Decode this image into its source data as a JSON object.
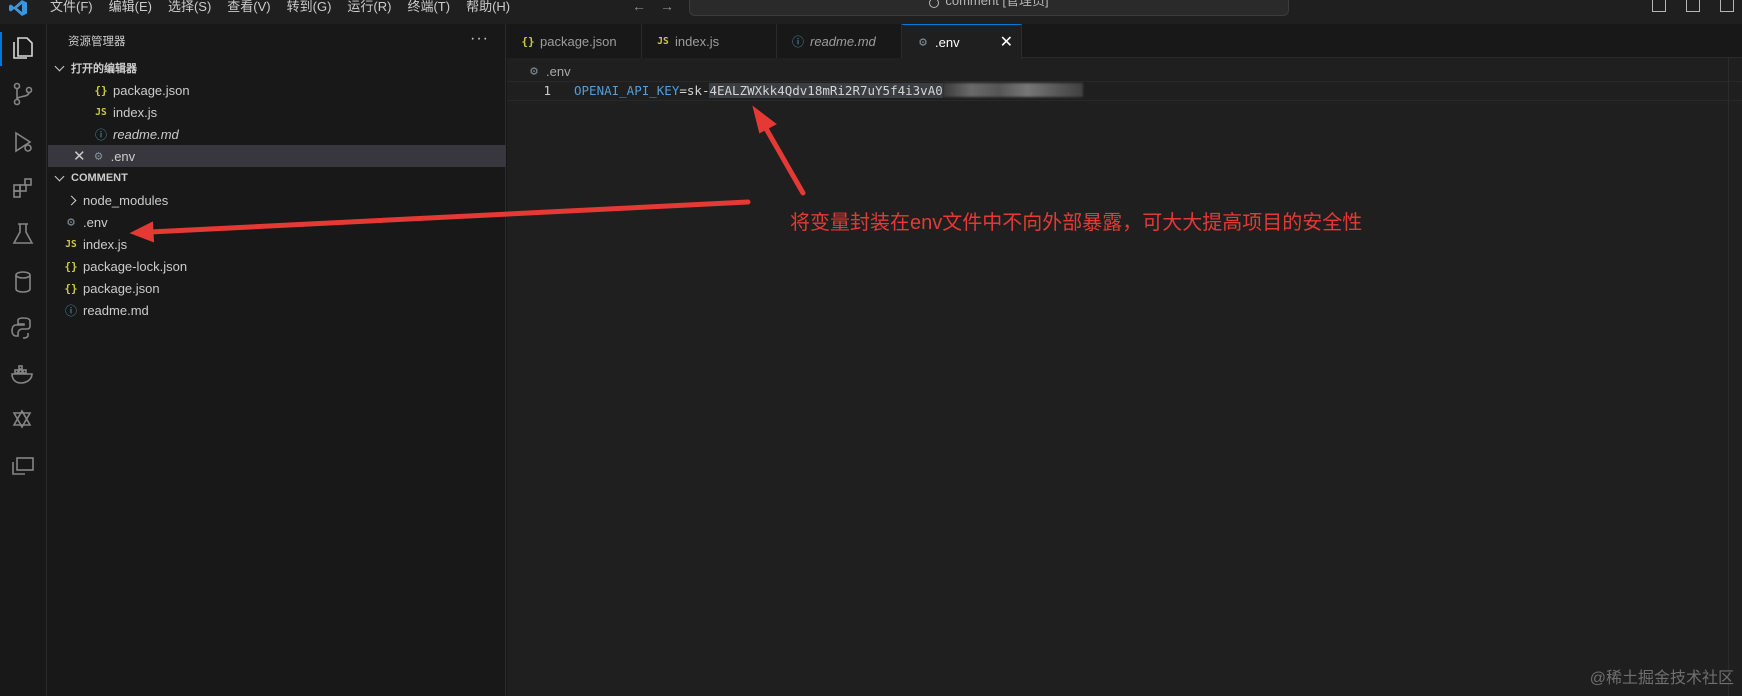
{
  "menubar": {
    "items": [
      "文件(F)",
      "编辑(E)",
      "选择(S)",
      "查看(V)",
      "转到(G)",
      "运行(R)",
      "终端(T)",
      "帮助(H)"
    ]
  },
  "command_center": {
    "text": "comment [管理员]",
    "icon": "search-icon"
  },
  "activity_bar": {
    "icons": [
      "explorer-icon",
      "source-control-icon",
      "run-debug-icon",
      "extensions-icon",
      "testing-icon",
      "database-icon",
      "python-icon",
      "docker-icon",
      "git-graph-icon",
      "remote-explorer-icon"
    ]
  },
  "sidebar": {
    "title": "资源管理器",
    "more": "···",
    "open_editors": {
      "label": "打开的编辑器",
      "items": [
        {
          "name": "package.json",
          "icon": "{}"
        },
        {
          "name": "index.js",
          "icon": "JS"
        },
        {
          "name": "readme.md",
          "icon": "ⓘ"
        },
        {
          "name": ".env",
          "icon": "⚙"
        }
      ]
    },
    "workspace": {
      "label": "COMMENT",
      "items": [
        {
          "name": "node_modules",
          "icon": ">"
        },
        {
          "name": ".env",
          "icon": "⚙"
        },
        {
          "name": "index.js",
          "icon": "JS"
        },
        {
          "name": "package-lock.json",
          "icon": "{}"
        },
        {
          "name": "package.json",
          "icon": "{}"
        },
        {
          "name": "readme.md",
          "icon": "ⓘ"
        }
      ]
    }
  },
  "editor": {
    "tabs": [
      {
        "label": "package.json",
        "icon": "{}"
      },
      {
        "label": "index.js",
        "icon": "JS"
      },
      {
        "label": "readme.md",
        "icon": "ⓘ"
      },
      {
        "label": ".env",
        "icon": "⚙",
        "close": "✕"
      }
    ],
    "breadcrumb": {
      "icon": "⚙",
      "label": ".env"
    },
    "line_number": "1",
    "code": {
      "key": "OPENAI_API_KEY",
      "eq": "=",
      "prefix": "sk-",
      "secret": "4EALZWXkk4Qdv18mRi2R7uY5f4i3vA0"
    }
  },
  "annotation": {
    "text": "将变量封装在env文件中不向外部暴露，可大大提高项目的安全性",
    "color": "#e53935"
  },
  "watermark": "@稀土掘金技术社区",
  "colors": {
    "accent": "#0078d4",
    "key_token": "#569cd6",
    "json_icon": "#cbcb41",
    "info_icon": "#519aba"
  }
}
